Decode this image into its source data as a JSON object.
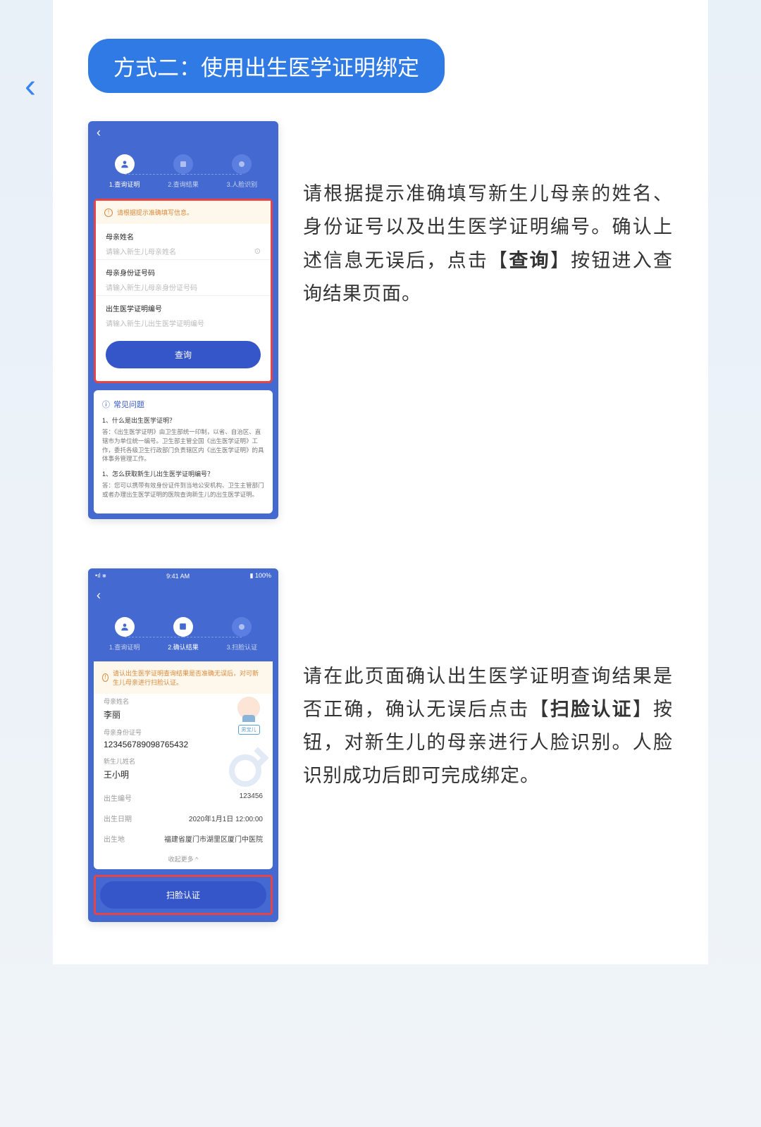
{
  "back_glyph": "‹",
  "title": "方式二：使用出生医学证明绑定",
  "section1": {
    "desc_parts": [
      "请根据提示准确填写新生儿母亲的姓名、身份证号以及出生医学证明编号。确认上述信息无误后，点击【",
      "查询",
      "】按钮进入查询结果页面。"
    ],
    "phone": {
      "steps": [
        "1.查询证明",
        "2.查询结果",
        "3.人脸识别"
      ],
      "warning": "请根据提示准确填写信息。",
      "fields": [
        {
          "label": "母亲姓名",
          "placeholder": "请输入新生儿母亲姓名"
        },
        {
          "label": "母亲身份证号码",
          "placeholder": "请输入新生儿母亲身份证号码"
        },
        {
          "label": "出生医学证明编号",
          "placeholder": "请输入新生儿出生医学证明编号"
        }
      ],
      "submit": "查询",
      "faq_title": "常见问题",
      "faq": [
        {
          "q": "1、什么是出生医学证明？",
          "a": "答：《出生医学证明》由卫生部统一印制，以省、自治区、直辖市为单位统一编号。卫生部主管全国《出生医学证明》工作，委托各级卫生行政部门负责辖区内《出生医学证明》的具体事务管理工作。"
        },
        {
          "q": "1、怎么获取新生儿出生医学证明编号？",
          "a": "答：您可以携带有效身份证件到当地公安机构、卫生主管部门或者办理出生医学证明的医院查询新生儿的出生医学证明。"
        }
      ]
    }
  },
  "section2": {
    "desc_parts": [
      "请在此页面确认出生医学证明查询结果是否正确，确认无误后点击【",
      "扫脸认证",
      "】按钮，对新生儿的母亲进行人脸识别。人脸识别成功后即可完成绑定。"
    ],
    "phone": {
      "status_time": "9:41 AM",
      "status_battery": "100%",
      "steps": [
        "1.查询证明",
        "2.确认结果",
        "3.扫脸认证"
      ],
      "warning": "请认出生医学证明查询结果是否准确无误后，对可新生儿母亲进行扫脸认证。",
      "baby_tag": "男宝儿",
      "mother_name_label": "母亲姓名",
      "mother_name": "李丽",
      "mother_id_label": "母亲身份证号",
      "mother_id": "123456789098765432",
      "baby_name_label": "新生儿姓名",
      "baby_name": "王小明",
      "rows": [
        {
          "label": "出生编号",
          "value": "123456"
        },
        {
          "label": "出生日期",
          "value": "2020年1月1日 12:00:00"
        },
        {
          "label": "出生地",
          "value": "福建省厦门市湖里区厦门中医院"
        }
      ],
      "collapse": "收起更多 ^",
      "submit": "扫脸认证"
    }
  }
}
